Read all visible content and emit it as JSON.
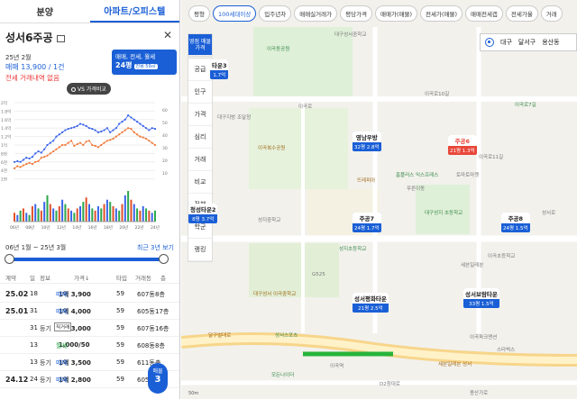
{
  "tabs": [
    "분양",
    "아파트/오피스텔"
  ],
  "complex": {
    "name": "성서6주공",
    "date": "25년 2월",
    "price": "매매 13,900 / 1건",
    "no_jeonse": "전세 거래내역 없음",
    "filter_line1": "매매, 전세, 월세",
    "filter_line2": "24평",
    "filter_tag": "전용 59㎡",
    "vs_label": "VS 가격비교"
  },
  "chart_data": {
    "type": "line",
    "title": "",
    "xlabel": "",
    "ylabel": "",
    "x_labels": [
      "06년",
      "08년",
      "10년",
      "12년",
      "14년",
      "16년",
      "18년",
      "20년",
      "22년",
      "24년"
    ],
    "y_left_ticks": [
      "2억",
      "1.8억",
      "1.6억",
      "1.4억",
      "1.2억",
      "1억",
      "8천",
      "6천",
      "4천",
      "2천"
    ],
    "y_right_ticks": [
      "60",
      "50",
      "40",
      "30",
      "20",
      "10"
    ],
    "ylim_left": [
      0,
      2
    ],
    "ylim_right": [
      0,
      60
    ],
    "series": [
      {
        "color": "#3a64e8",
        "values": [
          0.6,
          0.62,
          0.6,
          0.65,
          0.7,
          0.68,
          0.72,
          0.8,
          0.85,
          0.82,
          0.9,
          1.0,
          1.05,
          1.1,
          1.2,
          1.25,
          1.3,
          1.35,
          1.38,
          1.4,
          1.42,
          1.45,
          1.5,
          1.48,
          1.45,
          1.4,
          1.38,
          1.35,
          1.3,
          1.32,
          1.35,
          1.4,
          1.3,
          1.35,
          1.4,
          1.5,
          1.55,
          1.6,
          1.7,
          1.65,
          1.6,
          1.55,
          1.5,
          1.45,
          1.4,
          1.35,
          1.4,
          1.38
        ]
      },
      {
        "color": "#f07a3a",
        "values": [
          0.45,
          0.5,
          0.48,
          0.52,
          0.55,
          0.58,
          0.55,
          0.6,
          0.62,
          0.7,
          0.72,
          0.75,
          0.8,
          0.85,
          0.9,
          0.95,
          1.0,
          1.0,
          1.05,
          1.1,
          0.98,
          1.02,
          1.05,
          1.0,
          1.08,
          1.1,
          1.0,
          0.98,
          0.95,
          1.0,
          1.05,
          1.1,
          1.12,
          1.15,
          1.2,
          1.25,
          1.3,
          1.35,
          1.4,
          1.38,
          1.3,
          1.25,
          1.2,
          1.18,
          1.15,
          1.1,
          1.05,
          1.0
        ]
      }
    ],
    "volume": [
      4,
      3,
      5,
      6,
      4,
      3,
      7,
      8,
      6,
      5,
      9,
      12,
      8,
      6,
      5,
      7,
      10,
      8,
      6,
      5,
      4,
      6,
      7,
      9,
      11,
      8,
      6,
      5,
      7,
      6,
      8,
      10,
      9,
      7,
      6,
      5,
      8,
      12,
      14,
      10,
      8,
      6,
      5,
      7,
      6,
      5,
      4,
      5
    ]
  },
  "range": {
    "label": "06년 1월 ~ 25년 3월",
    "recent": "최근 3년 보기"
  },
  "table": {
    "headers": [
      "계약",
      "일",
      "정보",
      "가격↓",
      "타입",
      "거래동",
      "층"
    ],
    "rows": [
      {
        "month": "25.02",
        "day": "18",
        "info": "",
        "type_word": "매매",
        "price": "1억 3,900",
        "size": "59",
        "dong": "607동",
        "floor": "8층"
      },
      {
        "month": "25.01",
        "day": "31",
        "info": "",
        "type_word": "매매",
        "price": "1억 4,000",
        "size": "59",
        "dong": "605동",
        "floor": "17층"
      },
      {
        "month": "",
        "day": "31",
        "info": "등기",
        "type_word": "매매",
        "price": "1억 3,000",
        "size": "59",
        "dong": "607동",
        "floor": "16층"
      },
      {
        "month": "",
        "day": "13",
        "info": "",
        "type_word": "월세",
        "price": "1,000/50",
        "size": "59",
        "dong": "608동",
        "floor": "8층"
      },
      {
        "month": "",
        "day": "13",
        "info": "등기",
        "type_word": "매매",
        "price": "1억 3,500",
        "size": "59",
        "dong": "611동",
        "floor": "층"
      },
      {
        "month": "24.12",
        "day": "24",
        "info": "등기",
        "type_word": "매매",
        "price": "1억 2,800",
        "size": "59",
        "dong": "605동",
        "floor": "층"
      }
    ],
    "direct_tag": "직거래"
  },
  "fab": {
    "label": "매물",
    "count": "3"
  },
  "filters": [
    "평형",
    "100세대이상",
    "입주년차",
    "매매실거래가",
    "평당가격",
    "매매가(매물)",
    "전세가(매물)",
    "매매전세갭",
    "전세가율",
    "거래"
  ],
  "location": [
    "대구",
    "달서구",
    "용산동"
  ],
  "side_menu": [
    "영점 매물가격",
    "공급",
    "인구",
    "가격",
    "심리",
    "거래",
    "비교",
    "정책",
    "학군",
    "랭킹"
  ],
  "markers": [
    {
      "name": "타운3",
      "price": "1.7억"
    },
    {
      "name": "영남우방",
      "price": "32평 2.8억"
    },
    {
      "name": "주공6",
      "price": "21평 1.3억"
    },
    {
      "name": "청성타운2",
      "price": "8평 3.7억"
    },
    {
      "name": "주공7",
      "price": "24평 1.7억"
    },
    {
      "name": "주공8",
      "price": "24평 1.5억"
    },
    {
      "name": "성서평화타운",
      "price": "21평 2.5억"
    },
    {
      "name": "성서보람타운",
      "price": "33평 1.5억"
    }
  ],
  "map_labels": [
    "대구성서중학교",
    "이곡동공원",
    "대구지방 조달청",
    "이곡복수공원",
    "이곡로",
    "이곡로7길",
    "이곡로10길",
    "이곡로11길",
    "뜨레피아",
    "홈플러스 익스프레스",
    "푸른이동",
    "토마토마켓",
    "성지중학교",
    "대구성지 초등학교",
    "이곡초등학교",
    "세븐일레븐",
    "성서로",
    "성지초등학교",
    "대구성서 이곡중학교",
    "G525",
    "이곡역",
    "성서스포츠",
    "이곡파크맨션",
    "세븐일레븐 성서",
    "스타벅스",
    "모든나이더",
    "D2창대로",
    "용산가로",
    "달구벌대로"
  ]
}
